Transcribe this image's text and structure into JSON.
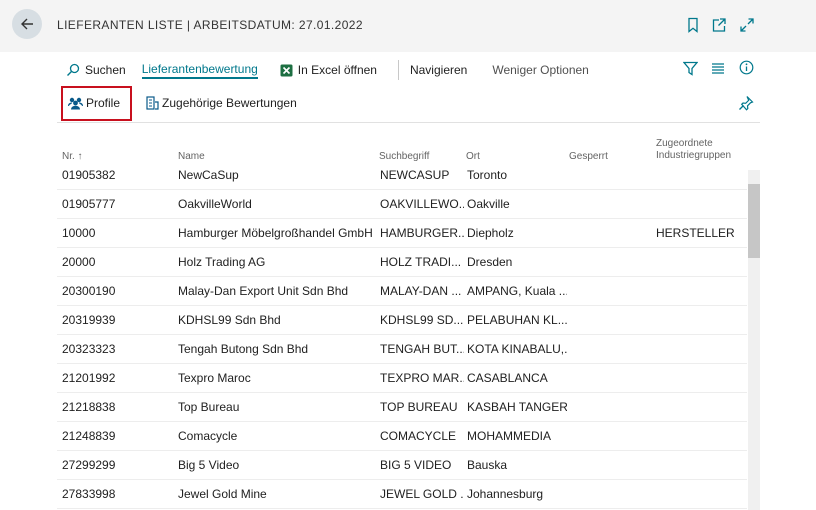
{
  "header": {
    "title": "LIEFERANTEN LISTE | ARBEITSDATUM: 27.01.2022",
    "icons": [
      "bookmark-icon",
      "share-icon",
      "expand-icon"
    ]
  },
  "actions": {
    "search": "Suchen",
    "vendor_rating": "Lieferantenbewertung",
    "open_excel": "In Excel öffnen",
    "navigate": "Navigieren",
    "fewer_options": "Weniger Optionen"
  },
  "subactions": {
    "profile": "Profile",
    "related_ratings": "Zugehörige Bewertungen"
  },
  "columns": {
    "nr": "Nr. ↑",
    "name": "Name",
    "search_term": "Suchbegriff",
    "city": "Ort",
    "blocked": "Gesperrt",
    "industry_line1": "Zugeordnete",
    "industry_line2": "Industriegruppen"
  },
  "rows": [
    {
      "nr": "01905382",
      "name": "NewCaSup",
      "search": "NEWCASUP",
      "city": "Toronto",
      "blocked": "",
      "industry": ""
    },
    {
      "nr": "01905777",
      "name": "OakvilleWorld",
      "search": "OAKVILLEWO...",
      "city": "Oakville",
      "blocked": "",
      "industry": ""
    },
    {
      "nr": "10000",
      "name": "Hamburger Möbelgroßhandel GmbH",
      "search": "HAMBURGER...",
      "city": "Diepholz",
      "blocked": "",
      "industry": "HERSTELLER"
    },
    {
      "nr": "20000",
      "name": "Holz Trading AG",
      "search": "HOLZ TRADI...",
      "city": "Dresden",
      "blocked": "",
      "industry": ""
    },
    {
      "nr": "20300190",
      "name": "Malay-Dan Export Unit Sdn Bhd",
      "search": "MALAY-DAN ...",
      "city": "AMPANG, Kuala ...",
      "blocked": "",
      "industry": ""
    },
    {
      "nr": "20319939",
      "name": "KDHSL99 Sdn Bhd",
      "search": "KDHSL99 SD...",
      "city": "PELABUHAN KL...",
      "blocked": "",
      "industry": ""
    },
    {
      "nr": "20323323",
      "name": "Tengah Butong Sdn Bhd",
      "search": "TENGAH BUT...",
      "city": "KOTA KINABALU,...",
      "blocked": "",
      "industry": ""
    },
    {
      "nr": "21201992",
      "name": "Texpro Maroc",
      "search": "TEXPRO MAR...",
      "city": "CASABLANCA",
      "blocked": "",
      "industry": ""
    },
    {
      "nr": "21218838",
      "name": "Top Bureau",
      "search": "TOP BUREAU",
      "city": "KASBAH TANGER",
      "blocked": "",
      "industry": ""
    },
    {
      "nr": "21248839",
      "name": "Comacycle",
      "search": "COMACYCLE",
      "city": "MOHAMMEDIA",
      "blocked": "",
      "industry": ""
    },
    {
      "nr": "27299299",
      "name": "Big 5 Video",
      "search": "BIG 5 VIDEO",
      "city": "Bauska",
      "blocked": "",
      "industry": ""
    },
    {
      "nr": "27833998",
      "name": "Jewel Gold Mine",
      "search": "JEWEL GOLD ...",
      "city": "Johannesburg",
      "blocked": "",
      "industry": ""
    }
  ],
  "colors": {
    "accent": "#00788c",
    "highlight_box": "#c8101e",
    "excel_green": "#1d6f42",
    "profile_icon": "#0a5a8a"
  }
}
